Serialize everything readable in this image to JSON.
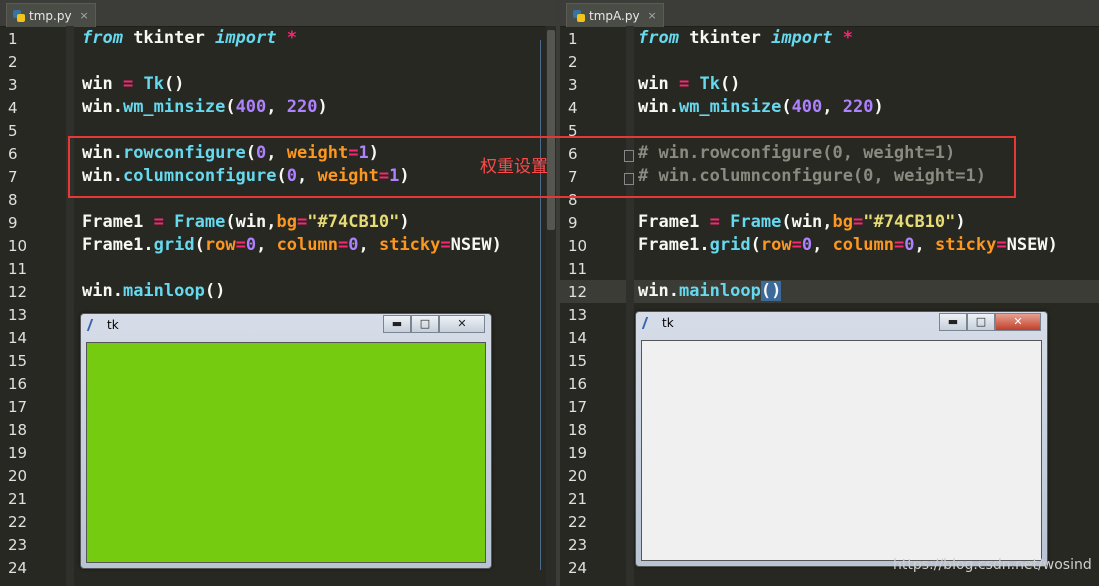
{
  "left_editor": {
    "tab": {
      "filename": "tmp.py",
      "close_glyph": "×"
    },
    "line_numbers": [
      "1",
      "2",
      "3",
      "4",
      "5",
      "6",
      "7",
      "8",
      "9",
      "10",
      "11",
      "12",
      "13",
      "14",
      "15",
      "16",
      "17",
      "18",
      "19",
      "20",
      "21",
      "22",
      "23",
      "24"
    ]
  },
  "right_editor": {
    "tab": {
      "filename": "tmpA.py",
      "close_glyph": "×"
    },
    "line_numbers": [
      "1",
      "2",
      "3",
      "4",
      "5",
      "6",
      "7",
      "8",
      "9",
      "10",
      "11",
      "12",
      "13",
      "14",
      "15",
      "16",
      "17",
      "18",
      "19",
      "20",
      "21",
      "22",
      "23",
      "24"
    ]
  },
  "tk_window_left": {
    "title": "tk",
    "buttons": [
      "▬",
      "□",
      "✕"
    ],
    "content_color": "#74CB10"
  },
  "tk_window_right": {
    "title": "tk",
    "buttons": [
      "▬",
      "□",
      "✕"
    ],
    "content_color": "#f0f0f0"
  },
  "annotation": {
    "label": "权重设置",
    "color": "#e53935"
  },
  "watermark": "https://blog.csdn.net/wosind",
  "theme": {
    "background": "#272822",
    "keyword": "#66d9ef",
    "operator": "#f92672",
    "number": "#ae81ff",
    "param": "#fd971f",
    "string": "#e6db74"
  }
}
